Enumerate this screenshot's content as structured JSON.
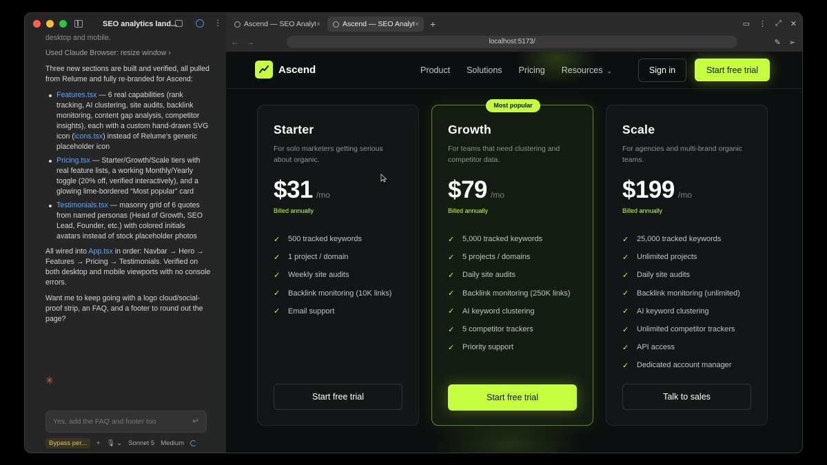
{
  "chat": {
    "title": "SEO analytics land...",
    "partial_line": "desktop and mobile.",
    "tool_line": "Used Claude Browser: resize window",
    "tool_chevron": "›",
    "intro": "Three new sections are built and verified, all pulled from Relume and fully re-branded for Ascend:",
    "bullets": [
      {
        "file": "Features.tsx",
        "text_a": " — 6 real capabilities (rank tracking, AI clustering, site audits, backlink monitoring, content gap analysis, competitor insights), each with a custom hand-drawn SVG icon (",
        "file2": "icons.tsx",
        "text_b": ") instead of Relume's generic placeholder icon"
      },
      {
        "file": "Pricing.tsx",
        "text_a": " — Starter/Growth/Scale tiers with real feature lists, a working Monthly/Yearly toggle (20% off, verified interactively), and a glowing lime-bordered “Most popular” card"
      },
      {
        "file": "Testimonials.tsx",
        "text_a": " — masonry grid of 6 quotes from named personas (Head of Growth, SEO Lead, Founder, etc.) with colored initials avatars instead of stock placeholder photos"
      }
    ],
    "wired_a": "All wired into ",
    "wired_file": "App.tsx",
    "wired_b": " in order: Navbar → Hero → Features → Pricing → Testimonials. Verified on both desktop and mobile viewports with no console errors.",
    "question": "Want me to keep going with a logo cloud/social-proof strip, an FAQ, and a footer to round out the page?",
    "spark": "✳",
    "input_placeholder": "Yes, add the FAQ and footer too",
    "send_icon": "↵",
    "footer": {
      "mode": "Bypass per...",
      "add": "+",
      "mic": "🎙 ⌄",
      "model": "Sonnet 5",
      "effort": "Medium"
    }
  },
  "browser": {
    "tabs": [
      {
        "label": "Ascend — SEO Analytics",
        "close": "×",
        "active": false
      },
      {
        "label": "Ascend — SEO Analytics",
        "close": "×",
        "active": true
      }
    ],
    "new_tab": "+",
    "url": "localhost:5173/",
    "back": "←",
    "forward": "→"
  },
  "site": {
    "brand": "Ascend",
    "nav": [
      "Product",
      "Solutions",
      "Pricing",
      "Resources"
    ],
    "resources_chevron": "⌄",
    "sign_in": "Sign in",
    "cta": "Start free trial",
    "plans": [
      {
        "name": "Starter",
        "desc": "For solo marketers getting serious about organic.",
        "price": "$31",
        "per": "/mo",
        "billed": "Billed annually",
        "features": [
          "500 tracked keywords",
          "1 project / domain",
          "Weekly site audits",
          "Backlink monitoring (10K links)",
          "Email support"
        ],
        "button": "Start free trial"
      },
      {
        "name": "Growth",
        "badge": "Most popular",
        "desc": "For teams that need clustering and competitor data.",
        "price": "$79",
        "per": "/mo",
        "billed": "Billed annually",
        "features": [
          "5,000 tracked keywords",
          "5 projects / domains",
          "Daily site audits",
          "Backlink monitoring (250K links)",
          "AI keyword clustering",
          "5 competitor trackers",
          "Priority support"
        ],
        "button": "Start free trial"
      },
      {
        "name": "Scale",
        "desc": "For agencies and multi-brand organic teams.",
        "price": "$199",
        "per": "/mo",
        "billed": "Billed annually",
        "features": [
          "25,000 tracked keywords",
          "Unlimited projects",
          "Daily site audits",
          "Backlink monitoring (unlimited)",
          "AI keyword clustering",
          "Unlimited competitor trackers",
          "API access",
          "Dedicated account manager"
        ],
        "button": "Talk to sales"
      }
    ]
  },
  "colors": {
    "accent": "#c6ff3d",
    "page_bg": "#0c0f0f",
    "link": "#5aa8ff"
  }
}
